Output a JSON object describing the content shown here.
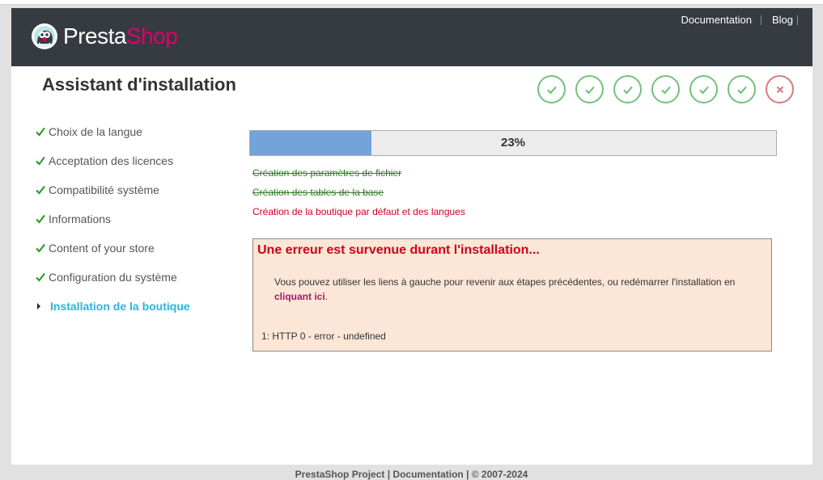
{
  "header": {
    "logo_text_presta": "Presta",
    "logo_text_shop": "Shop",
    "nav": [
      {
        "label": "Documentation"
      },
      {
        "label": "Blog"
      }
    ]
  },
  "page": {
    "title": "Assistant d'installation"
  },
  "step_icons": [
    {
      "status": "done",
      "icon": "check-icon"
    },
    {
      "status": "done",
      "icon": "check-icon"
    },
    {
      "status": "done",
      "icon": "check-icon"
    },
    {
      "status": "done",
      "icon": "check-icon"
    },
    {
      "status": "done",
      "icon": "check-icon"
    },
    {
      "status": "done",
      "icon": "check-icon"
    },
    {
      "status": "failed",
      "icon": "close-icon"
    }
  ],
  "sidebar": {
    "items": [
      {
        "label": "Choix de la langue",
        "status": "done"
      },
      {
        "label": "Acceptation des licences",
        "status": "done"
      },
      {
        "label": "Compatibilité système",
        "status": "done"
      },
      {
        "label": "Informations",
        "status": "done"
      },
      {
        "label": "Content of your store",
        "status": "done"
      },
      {
        "label": "Configuration du système",
        "status": "done"
      },
      {
        "label": "Installation de la boutique",
        "status": "active"
      }
    ]
  },
  "progress": {
    "value": 0.23,
    "label": "23%"
  },
  "tasks": [
    {
      "label": "Création des paramètres de fichier",
      "status": "done"
    },
    {
      "label": "Création des tables de la base",
      "status": "done"
    },
    {
      "label": "Création de la boutique par défaut et des langues",
      "status": "failed"
    }
  ],
  "error": {
    "title": "Une erreur est survenue durant l'installation...",
    "message_before": "Vous pouvez utiliser les liens à gauche pour revenir aux étapes précédentes, ou redémarrer l'installation en ",
    "link_label": "cliquant ici",
    "message_after": ".",
    "detail": "1: HTTP 0 - error - undefined"
  },
  "footer": {
    "text": "PrestaShop Project | Documentation | © 2007-2024"
  },
  "colors": {
    "header_bg": "#363a41",
    "brand_pink": "#df0067",
    "active_step": "#25b9d7",
    "check_green": "#2f9a2f",
    "error_red": "#d0021b",
    "progress_fill": "#72a3d9"
  }
}
